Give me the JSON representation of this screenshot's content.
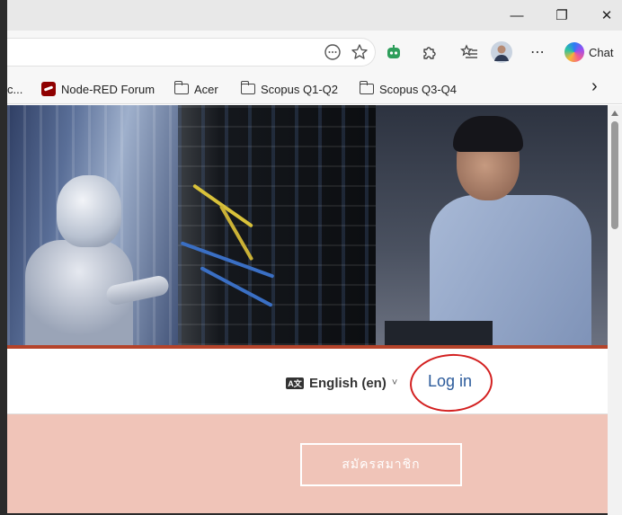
{
  "window": {
    "minimize_glyph": "—",
    "maximize_glyph": "❐",
    "close_glyph": "✕"
  },
  "toolbar": {
    "icons": [
      "read-aloud-icon",
      "favorite-star-icon",
      "extension-robot-icon",
      "extensions-puzzle-icon",
      "favorites-list-icon",
      "profile-avatar",
      "more-menu-icon"
    ],
    "more_glyph": "⋯",
    "chat_label": "Chat"
  },
  "bookmarks": {
    "items": [
      {
        "label": "c...",
        "icon": "none"
      },
      {
        "label": "Node-RED Forum",
        "icon": "node-red-icon"
      },
      {
        "label": "Acer",
        "icon": "folder-icon"
      },
      {
        "label": "Scopus Q1-Q2",
        "icon": "folder-icon"
      },
      {
        "label": "Scopus Q3-Q4",
        "icon": "folder-icon"
      }
    ],
    "overflow_glyph": "›"
  },
  "nav": {
    "lang_icon_text": "A文",
    "language": "English (en)",
    "caret": "˅",
    "login": "Log in"
  },
  "pink_section": {
    "signup": "สมัครสมาชิก"
  },
  "colors": {
    "accent_link": "#2c5b9b",
    "annotation_red": "#d32020",
    "pink_bg": "#f0c4b8",
    "strip_orange": "#b4432a"
  }
}
